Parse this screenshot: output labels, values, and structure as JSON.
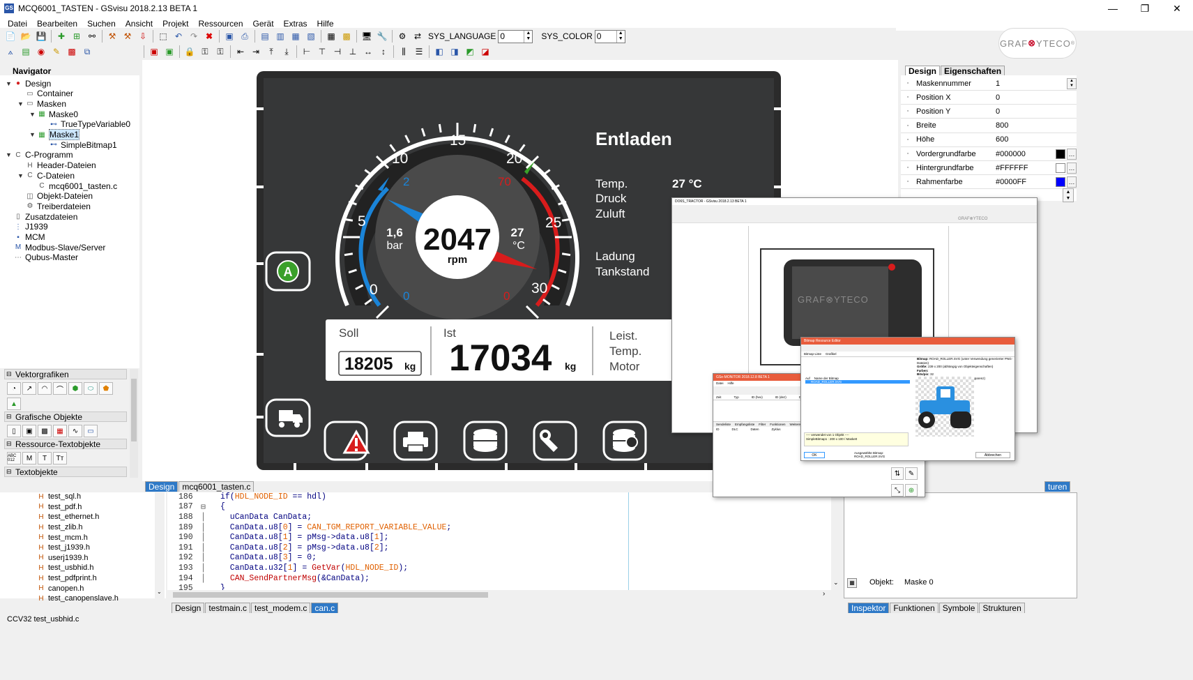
{
  "window": {
    "title": "MCQ6001_TASTEN - GSvisu 2018.2.13 BETA 1",
    "app_icon": "GS",
    "min": "—",
    "max": "❐",
    "close": "✕"
  },
  "menu": [
    "Datei",
    "Bearbeiten",
    "Suchen",
    "Ansicht",
    "Projekt",
    "Ressourcen",
    "Gerät",
    "Extras",
    "Hilfe"
  ],
  "toolbar": {
    "lang_label": "SYS_LANGUAGE",
    "lang_value": "0",
    "color_label": "SYS_COLOR",
    "color_value": "0"
  },
  "logo": {
    "pre": "GRAF",
    "o": "⊗",
    "post": "YTECO",
    "reg": "®"
  },
  "navigator": {
    "title": "Navigator",
    "items": [
      {
        "label": "Design",
        "level": 0,
        "twisty": "▼",
        "icon": "design-icon"
      },
      {
        "label": "Container",
        "level": 1,
        "twisty": "",
        "icon": "folder-icon"
      },
      {
        "label": "Masken",
        "level": 1,
        "twisty": "▼",
        "icon": "folder-icon"
      },
      {
        "label": "Maske0",
        "level": 2,
        "twisty": "▼",
        "icon": "mask-icon"
      },
      {
        "label": "TrueTypeVariable0",
        "level": 3,
        "twisty": "",
        "icon": "variable-icon"
      },
      {
        "label": "Maske1",
        "level": 2,
        "twisty": "▼",
        "icon": "mask-icon",
        "selected": true
      },
      {
        "label": "SimpleBitmap1",
        "level": 3,
        "twisty": "",
        "icon": "variable-icon"
      },
      {
        "label": "C-Programm",
        "level": 0,
        "twisty": "▼",
        "icon": "c-file-icon"
      },
      {
        "label": "Header-Dateien",
        "level": 1,
        "twisty": "",
        "icon": "header-icon"
      },
      {
        "label": "C-Dateien",
        "level": 1,
        "twisty": "▼",
        "icon": "c-file-icon"
      },
      {
        "label": "mcq6001_tasten.c",
        "level": 2,
        "twisty": "",
        "icon": "c-file-icon"
      },
      {
        "label": "Objekt-Dateien",
        "level": 1,
        "twisty": "",
        "icon": "object-icon"
      },
      {
        "label": "Treiberdateien",
        "level": 1,
        "twisty": "",
        "icon": "driver-icon"
      },
      {
        "label": "Zusatzdateien",
        "level": 0,
        "twisty": "",
        "icon": "file-icon"
      },
      {
        "label": "J1939",
        "level": 0,
        "twisty": "",
        "icon": "j1939-icon"
      },
      {
        "label": "MCM",
        "level": 0,
        "twisty": "",
        "icon": "mcm-icon"
      },
      {
        "label": "Modbus-Slave/Server",
        "level": 0,
        "twisty": "",
        "icon": "modbus-icon"
      },
      {
        "label": "Qubus-Master",
        "level": 0,
        "twisty": "",
        "icon": "qubus-icon"
      }
    ]
  },
  "palettes": [
    "Vektorgrafiken",
    "Grafische Objekte",
    "Ressource-Textobjekte",
    "Textobjekte"
  ],
  "palette_text_buttons": [
    "ABC 012",
    "M",
    "T",
    "Tт"
  ],
  "display": {
    "ticks": [
      "0",
      "5",
      "10",
      "15",
      "20",
      "25",
      "30"
    ],
    "inner_left": [
      "0",
      "2"
    ],
    "inner_right": [
      "0",
      "70"
    ],
    "rpm_value": "2047",
    "rpm_unit": "rpm",
    "bar_value": "1,6",
    "bar_unit": "bar",
    "temp_value": "27",
    "temp_unit": "°C",
    "heading": "Entladen",
    "temp_label": "Temp.",
    "temp_reading": "27 °C",
    "druck_label": "Druck",
    "zuluft_label": "Zuluft",
    "ladung_label": "Ladung",
    "tankstand_label": "Tankstand",
    "soll_label": "Soll",
    "soll_value": "18205",
    "soll_unit": "kg",
    "ist_label": "Ist",
    "ist_value": "17034",
    "ist_unit": "kg",
    "leist_label": "Leist.",
    "temp2_label": "Temp.",
    "motor_label": "Motor",
    "button_a": "A"
  },
  "canvas_tabs": [
    "Design",
    "mcq6001_tasten.c"
  ],
  "file_list": [
    "test_sql.h",
    "test_pdf.h",
    "test_ethernet.h",
    "test_zlib.h",
    "test_mcm.h",
    "test_j1939.h",
    "userj1939.h",
    "test_usbhid.h",
    "test_pdfprint.h",
    "canopen.h",
    "test_canopenslave.h"
  ],
  "code": [
    {
      "n": "186",
      "t": "if(HDL_NODE_ID == hdl)"
    },
    {
      "n": "187",
      "t": "{"
    },
    {
      "n": "188",
      "t": "  uCanData CanData;"
    },
    {
      "n": "189",
      "t": "  CanData.u8[0] = CAN_TGM_REPORT_VARIABLE_VALUE;"
    },
    {
      "n": "190",
      "t": "  CanData.u8[1] = pMsg->data.u8[1];"
    },
    {
      "n": "191",
      "t": "  CanData.u8[2] = pMsg->data.u8[2];"
    },
    {
      "n": "192",
      "t": "  CanData.u8[3] = 0;"
    },
    {
      "n": "193",
      "t": "  CanData.u32[1] = GetVar(HDL_NODE_ID);"
    },
    {
      "n": "194",
      "t": "  CAN_SendPartnerMsg(&CanData);"
    },
    {
      "n": "195",
      "t": "}"
    }
  ],
  "editor_tabs": [
    "Design",
    "testmain.c",
    "test_modem.c",
    "can.c"
  ],
  "props_tabs": [
    "Design",
    "Eigenschaften"
  ],
  "properties": [
    {
      "name": "Maskennummer",
      "value": "1"
    },
    {
      "name": "Position X",
      "value": "0"
    },
    {
      "name": "Position Y",
      "value": "0"
    },
    {
      "name": "Breite",
      "value": "800"
    },
    {
      "name": "Höhe",
      "value": "600"
    },
    {
      "name": "Vordergrundfarbe",
      "value": "#000000",
      "swatch": "#000000"
    },
    {
      "name": "Hintergrundfarbe",
      "value": "#FFFFFF",
      "swatch": "#FFFFFF"
    },
    {
      "name": "Rahmenfarbe",
      "value": "#0000FF",
      "swatch": "#0000FF"
    }
  ],
  "inspector": {
    "object_label": "Objekt:",
    "object_value": "Maske 0",
    "tab_strukturen": "turen"
  },
  "bottom_tabs": [
    "Inspektor",
    "Funktionen",
    "Symbole",
    "Strukturen"
  ],
  "status": "CCV32 test_usbhid.c",
  "overlays": {
    "main_title": "DO6S_TRACTOR - GSvisu 2018.2.13 BETA 1",
    "monitor_title": "GSe-MONITOR 2018.12.8 BETA 1",
    "monitor_menu": [
      "Datei",
      "Hilfe"
    ],
    "monitor_cols": [
      "Zeit",
      "Typ",
      "ID (hex)",
      "ID (dez)",
      "DLC"
    ],
    "monitor_tabs": [
      "Sendeliste",
      "Empfangsliste",
      "Filter",
      "Funktionen",
      "Weitere Tools"
    ],
    "monitor_cols2": [
      "ID",
      "DLC",
      "Daten",
      "Zyklus"
    ],
    "bitmap_title": "Bitmap Resource Editor",
    "bitmap_tabs": [
      "Bitmap-Liste",
      "Grafikel"
    ],
    "bitmap_cols": [
      "Auf",
      "Name der Bitmap"
    ],
    "bitmap_row": "ROAD_ROLLER.SVG",
    "bitmap_info": [
      "Bitmap:",
      "Größe:",
      "Farben:",
      "Bits/pix:",
      "Transparenz:"
    ],
    "bitmap_info_vals": [
      "ROAD_ROLLER.SVG (unter Verwendung generierter PNG-Dateien)",
      "239 x 200 (abhängig von Objekteigenschaften)",
      "",
      "32",
      "Ja (Gerät unterstützt Transparenz)"
    ],
    "bitmap_ok": "OK",
    "bitmap_cancel": "Abbrechen",
    "bitmap_selected_label": "Ausgewählte Bitmap:",
    "bitmap_selected": "ROAD_ROLLER.SVG",
    "bitmap_used": "---- verwendet von 1 Objekt ----",
    "bitmap_used_obj": "SimpleBitmap1 : 200 x 100 / Maske0",
    "logo_text": "GRAF⊗YTECO"
  }
}
